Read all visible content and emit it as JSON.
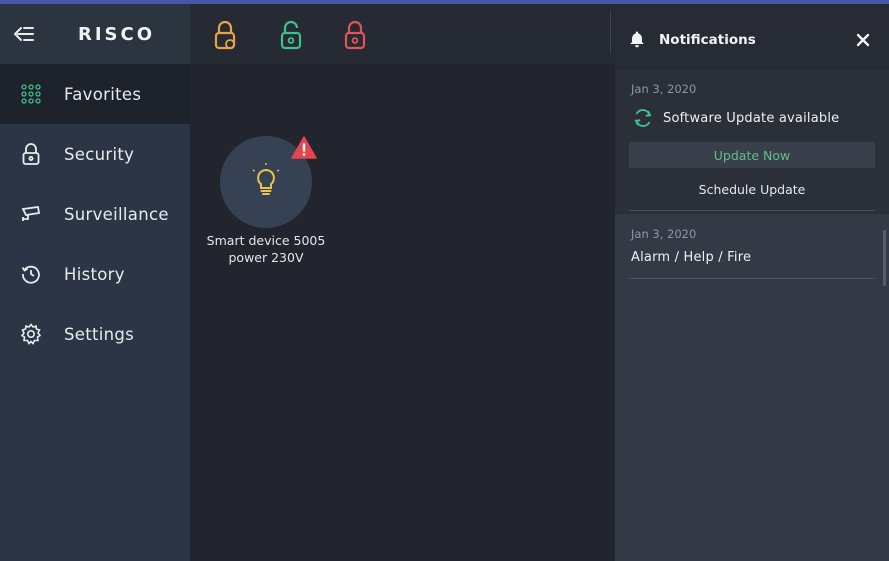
{
  "header": {
    "logo_text": "RISCO",
    "colors": {
      "lock_partial": "#e8a24a",
      "lock_open": "#3fbf8a",
      "lock_closed": "#e0545a"
    }
  },
  "sidebar": {
    "items": [
      {
        "label": "Favorites",
        "icon": "grid-icon",
        "active": true
      },
      {
        "label": "Security",
        "icon": "lock-icon",
        "active": false
      },
      {
        "label": "Surveillance",
        "icon": "camera-icon",
        "active": false
      },
      {
        "label": "History",
        "icon": "history-icon",
        "active": false
      },
      {
        "label": "Settings",
        "icon": "gear-icon",
        "active": false
      }
    ]
  },
  "main": {
    "devices": [
      {
        "label_line1": "Smart device 5005",
        "label_line2": "power 230V",
        "icon": "bulb-icon",
        "alert": true
      }
    ]
  },
  "notifications": {
    "title": "Notifications",
    "items": [
      {
        "date": "Jan 3, 2020",
        "text": "Software Update available",
        "action_primary": "Update Now",
        "action_secondary": "Schedule Update"
      },
      {
        "date": "Jan 3, 2020",
        "text": "Alarm / Help / Fire"
      }
    ]
  }
}
